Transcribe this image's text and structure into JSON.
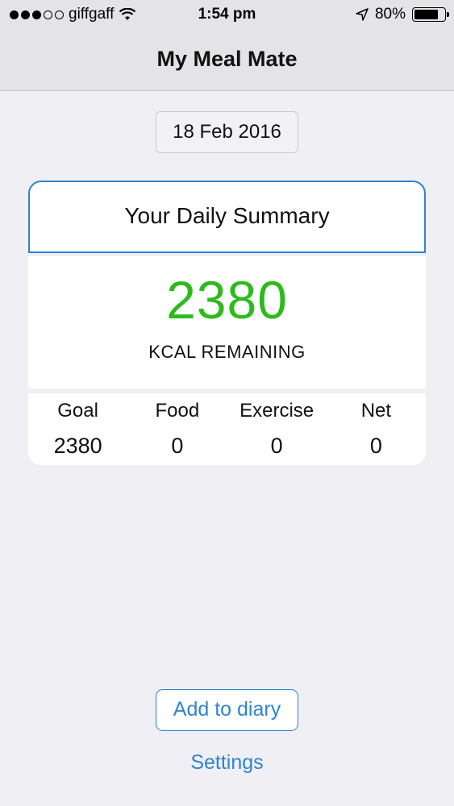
{
  "status_bar": {
    "signal_bars_filled": 3,
    "signal_bars_total": 5,
    "carrier": "giffgaff",
    "time": "1:54 pm",
    "battery_percent": "80%",
    "battery_level": 0.8,
    "icons": [
      "wifi-icon",
      "location-arrow-icon",
      "battery-icon"
    ]
  },
  "nav": {
    "title": "My Meal Mate"
  },
  "date_button": {
    "label": "18 Feb 2016"
  },
  "summary": {
    "title": "Your Daily Summary",
    "remaining_value": "2380",
    "remaining_label": "KCAL REMAINING",
    "stats": [
      {
        "label": "Goal",
        "value": "2380"
      },
      {
        "label": "Food",
        "value": "0"
      },
      {
        "label": "Exercise",
        "value": "0"
      },
      {
        "label": "Net",
        "value": "0"
      }
    ]
  },
  "actions": {
    "add_label": "Add to diary",
    "settings_label": "Settings"
  },
  "colors": {
    "accent": "#2f84cf",
    "remaining": "#2dbb1b",
    "background": "#efeff4"
  }
}
